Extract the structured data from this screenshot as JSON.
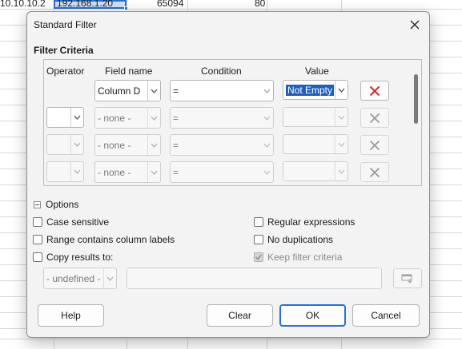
{
  "spreadsheet": {
    "row_cell_a": "10.10.10.2",
    "row_cell_b": "192.168.1.20",
    "row_cell_c": "65094",
    "row_cell_d": "80"
  },
  "dialog": {
    "title": "Standard Filter",
    "criteria_title": "Filter Criteria",
    "headers": {
      "operator": "Operator",
      "field_name": "Field name",
      "condition": "Condition",
      "value": "Value"
    },
    "rows": [
      {
        "operator": "",
        "field": "Column D",
        "condition": "=",
        "value": "Not Empty"
      },
      {
        "operator": "",
        "field": "- none -",
        "condition": "=",
        "value": ""
      },
      {
        "operator": "",
        "field": "- none -",
        "condition": "=",
        "value": ""
      },
      {
        "operator": "",
        "field": "- none -",
        "condition": "=",
        "value": ""
      }
    ],
    "options": {
      "label": "Options",
      "case_sensitive": "Case sensitive",
      "regular_expressions": "Regular expressions",
      "range_contains_labels": "Range contains column labels",
      "no_duplications": "No duplications",
      "copy_results": "Copy results to:",
      "keep_filter": "Keep filter criteria",
      "copy_target": "- undefined -"
    },
    "buttons": {
      "help": "Help",
      "clear": "Clear",
      "ok": "OK",
      "cancel": "Cancel"
    }
  },
  "colors": {
    "accent": "#2a6fd6",
    "delete_active": "#d12b2b",
    "delete_disabled": "#9a9a9a"
  },
  "icons": {
    "close": "close-icon",
    "dropdown": "chevron-down-icon",
    "delete": "x-icon",
    "shrink": "shrink-icon"
  }
}
